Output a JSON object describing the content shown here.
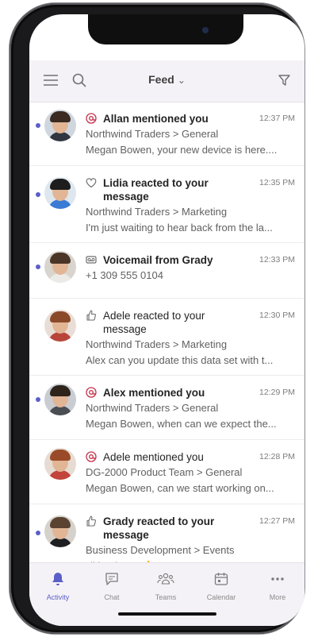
{
  "header": {
    "title": "Feed",
    "chevron": "⌄"
  },
  "colors": {
    "accent": "#5b5fc7",
    "mention": "#c4314b",
    "unread_dot": "#5b5fc7"
  },
  "feed": {
    "items": [
      {
        "icon": "mention-icon",
        "title": "Allan mentioned you",
        "time": "12:37 PM",
        "line1": "Northwind Traders > General",
        "line2": "Megan Bowen, your new device is here....",
        "unread": true,
        "bold": true
      },
      {
        "icon": "heart-icon",
        "title": "Lidia reacted to your message",
        "time": "12:35 PM",
        "line1": "Northwind Traders > Marketing",
        "line2": "I'm just waiting to hear back from the la...",
        "unread": true,
        "bold": true
      },
      {
        "icon": "voicemail-icon",
        "title": "Voicemail from Grady",
        "time": "12:33 PM",
        "line1": "+1 309 555 0104",
        "line2": "",
        "unread": true,
        "bold": true
      },
      {
        "icon": "thumbs-up-icon",
        "title": "Adele reacted to your message",
        "time": "12:30 PM",
        "line1": "Northwind Traders > Marketing",
        "line2": "Alex can you update this data set with t...",
        "unread": false,
        "bold": false
      },
      {
        "icon": "mention-icon",
        "title": "Alex mentioned you",
        "time": "12:29 PM",
        "line1": "Northwind Traders > General",
        "line2": "Megan Bowen, when can we expect the...",
        "unread": true,
        "bold": true
      },
      {
        "icon": "mention-icon",
        "title": "Adele mentioned you",
        "time": "12:28 PM",
        "line1": "DG-2000 Product Team > General",
        "line2": "Megan Bowen, can we start working on...",
        "unread": false,
        "bold": false
      },
      {
        "icon": "thumbs-up-icon",
        "title": "Grady reacted to your message",
        "time": "12:27 PM",
        "line1": "Business Development > Events",
        "line2": "I'll be there! 👍",
        "unread": true,
        "bold": true
      }
    ]
  },
  "tabs": [
    {
      "label": "Activity",
      "icon": "bell-icon",
      "active": true
    },
    {
      "label": "Chat",
      "icon": "chat-icon",
      "active": false
    },
    {
      "label": "Teams",
      "icon": "teams-icon",
      "active": false
    },
    {
      "label": "Calendar",
      "icon": "calendar-icon",
      "active": false
    },
    {
      "label": "More",
      "icon": "more-icon",
      "active": false
    }
  ]
}
